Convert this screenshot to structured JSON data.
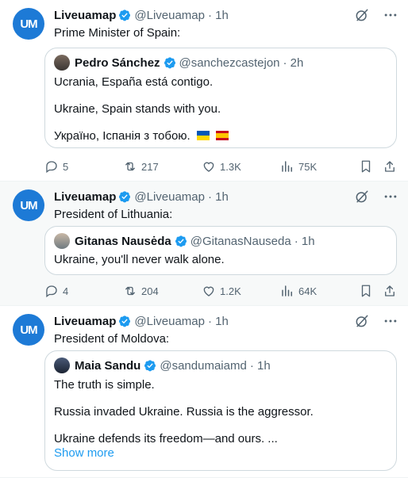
{
  "colors": {
    "accent": "#1d9bf0",
    "muted": "#536471",
    "avatar": "#1d7ad6"
  },
  "tweets": [
    {
      "author": "Liveuamap",
      "handle": "@Liveuamap",
      "time": "· 1h",
      "avatar_text": "UM",
      "text": "Prime Minister of Spain:",
      "quote": {
        "author": "Pedro Sánchez",
        "handle": "@sanchezcastejon",
        "time": "· 2h",
        "lines": [
          "Ucrania, España está contigo.",
          "Ukraine, Spain stands with you.",
          "Україно, Іспанія з тобою."
        ],
        "flags": [
          "ukraine-flag",
          "spain-flag"
        ]
      },
      "stats": {
        "replies": "5",
        "reposts": "217",
        "likes": "1.3K",
        "views": "75K"
      }
    },
    {
      "author": "Liveuamap",
      "handle": "@Liveuamap",
      "time": "· 1h",
      "avatar_text": "UM",
      "text": "President of Lithuania:",
      "quote": {
        "author": "Gitanas Nausėda",
        "handle": "@GitanasNauseda",
        "time": "· 1h",
        "lines": [
          "Ukraine, you'll never walk alone."
        ]
      },
      "stats": {
        "replies": "4",
        "reposts": "204",
        "likes": "1.2K",
        "views": "64K"
      }
    },
    {
      "author": "Liveuamap",
      "handle": "@Liveuamap",
      "time": "· 1h",
      "avatar_text": "UM",
      "text": "President of Moldova:",
      "quote": {
        "author": "Maia Sandu",
        "handle": "@sandumaiamd",
        "time": "· 1h",
        "lines": [
          "The truth is simple.",
          "Russia invaded Ukraine. Russia is the aggressor.",
          "Ukraine defends its freedom—and ours. ..."
        ],
        "show_more": "Show more"
      }
    }
  ]
}
